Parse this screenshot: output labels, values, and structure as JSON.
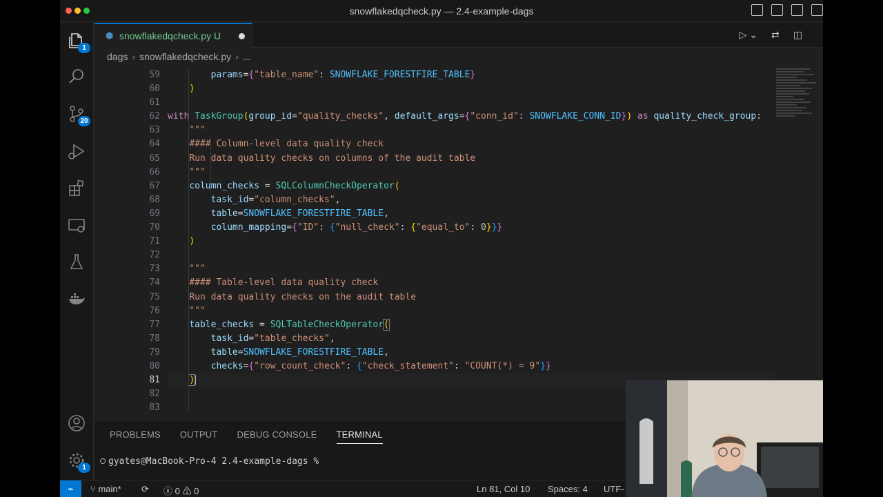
{
  "window": {
    "title": "snowflakedqcheck.py — 2.4-example-dags"
  },
  "tab": {
    "name": "snowflakedqcheck.py",
    "status": "U"
  },
  "breadcrumb": {
    "folder": "dags",
    "file": "snowflakedqcheck.py",
    "more": "..."
  },
  "activity": {
    "explorer_badge": "1",
    "scm_badge": "20",
    "settings_badge": "1"
  },
  "editor": {
    "line_numbers": [
      "59",
      "60",
      "61",
      "62",
      "63",
      "64",
      "65",
      "66",
      "67",
      "68",
      "69",
      "70",
      "71",
      "72",
      "73",
      "74",
      "75",
      "76",
      "77",
      "78",
      "79",
      "80",
      "81",
      "82",
      "83"
    ],
    "active_line": "81"
  },
  "panel": {
    "tabs": [
      "PROBLEMS",
      "OUTPUT",
      "DEBUG CONSOLE",
      "TERMINAL"
    ],
    "active_tab": "TERMINAL",
    "terminal_prompt": "gyates@MacBook-Pro-4 2.4-example-dags %"
  },
  "statusbar": {
    "branch": "main*",
    "errors": "0",
    "warnings": "0",
    "cursor": "Ln 81, Col 10",
    "spaces": "Spaces: 4",
    "encoding": "UTF-"
  },
  "colors": {
    "accent": "#0078d4",
    "keyword": "#c586c0",
    "string": "#ce9178",
    "variable": "#9cdcfe",
    "constant": "#4fc1ff",
    "function": "#dcdcaa",
    "class": "#4ec9b0",
    "number": "#b5cea8"
  }
}
